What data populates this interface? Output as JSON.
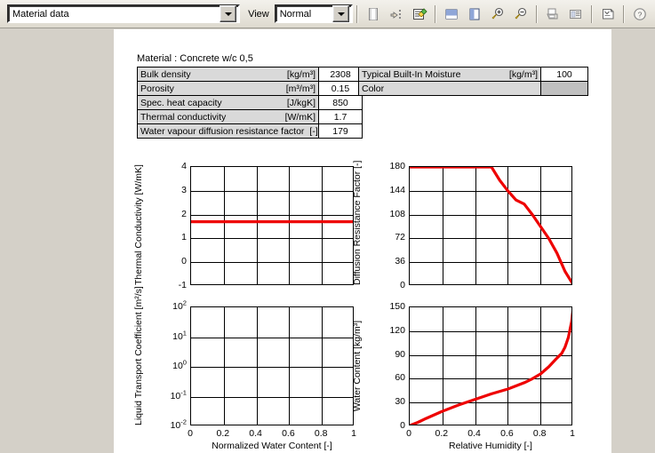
{
  "toolbar": {
    "material_combo": {
      "value": "Material data",
      "icon": "chevron-down-icon"
    },
    "view_label": "View",
    "view_combo": {
      "value": "Normal",
      "icon": "chevron-down-icon"
    },
    "buttons": [
      {
        "name": "new-document-icon",
        "title": "New"
      },
      {
        "name": "open-folder-icon",
        "title": "Open"
      },
      {
        "name": "edit-material-icon",
        "title": "Edit material"
      },
      {
        "name": "view-single-page-icon",
        "title": "Single page"
      },
      {
        "name": "view-full-page-icon",
        "title": "Full page"
      },
      {
        "name": "zoom-in-icon",
        "title": "Zoom in"
      },
      {
        "name": "zoom-out-icon",
        "title": "Zoom out"
      },
      {
        "name": "print-icon",
        "title": "Print"
      },
      {
        "name": "report-list-icon",
        "title": "Report"
      },
      {
        "name": "notes-icon",
        "title": "Notes"
      },
      {
        "name": "help-icon",
        "title": "Help"
      }
    ]
  },
  "document": {
    "material_title": "Material : Concrete w/c 0,5",
    "table_left": {
      "rows": [
        {
          "label": "Bulk density",
          "unit": "[kg/m³]",
          "value": "2308"
        },
        {
          "label": "Porosity",
          "unit": "[m³/m³]",
          "value": "0.15"
        },
        {
          "label": "Spec. heat capacity",
          "unit": "[J/kgK]",
          "value": "850"
        },
        {
          "label": "Thermal conductivity",
          "unit": "[W/mK]",
          "value": "1.7"
        },
        {
          "label": "Water vapour diffusion resistance factor",
          "unit": "[-]",
          "value": "179"
        }
      ]
    },
    "table_right": {
      "rows": [
        {
          "label": "Typical Built-In Moisture",
          "unit": "[kg/m³]",
          "value": "100",
          "swatch": false
        },
        {
          "label": "Color",
          "unit": "",
          "value": "",
          "swatch": true
        }
      ]
    }
  },
  "chart_data": [
    {
      "id": "thermal-conductivity",
      "type": "line",
      "title": "",
      "xlabel": "",
      "ylabel": "Thermal Conductivity [W/mK]",
      "xlim": [
        0,
        1
      ],
      "ylim": [
        -1,
        4
      ],
      "yticks": [
        -1,
        0,
        1,
        2,
        3,
        4
      ],
      "yticklabels": [
        "-1",
        "0",
        "1",
        "2",
        "3",
        "4"
      ],
      "xticks": [
        0,
        0.2,
        0.4,
        0.6,
        0.8,
        1
      ],
      "xticklabels": [
        "",
        "",
        "",
        "",
        "",
        ""
      ],
      "grid": true,
      "color": "#ee0000",
      "x": [
        0,
        0.2,
        0.4,
        0.6,
        0.8,
        1.0
      ],
      "y": [
        1.7,
        1.7,
        1.7,
        1.7,
        1.7,
        1.7
      ]
    },
    {
      "id": "diffusion-resistance-factor",
      "type": "line",
      "title": "",
      "xlabel": "",
      "ylabel": "Diffusion Resistance Factor [-]",
      "xlim": [
        0,
        1
      ],
      "ylim": [
        0,
        180
      ],
      "yticks": [
        0,
        36,
        72,
        108,
        144,
        180
      ],
      "yticklabels": [
        "0",
        "36",
        "72",
        "108",
        "144",
        "180"
      ],
      "xticks": [
        0,
        0.2,
        0.4,
        0.6,
        0.8,
        1
      ],
      "xticklabels": [
        "",
        "",
        "",
        "",
        "",
        ""
      ],
      "grid": true,
      "color": "#ee0000",
      "x": [
        0,
        0.1,
        0.2,
        0.3,
        0.4,
        0.5,
        0.55,
        0.6,
        0.65,
        0.7,
        0.75,
        0.8,
        0.85,
        0.9,
        0.95,
        1.0
      ],
      "y": [
        180,
        180,
        180,
        180,
        180,
        180,
        160,
        144,
        130,
        124,
        108,
        90,
        72,
        50,
        22,
        2
      ]
    },
    {
      "id": "liquid-transport-coefficient",
      "type": "line",
      "title": "",
      "xlabel": "Normalized Water Content [-]",
      "ylabel": "Liquid Transport Coefficient [m²/s]",
      "yscale": "log",
      "xlim": [
        0,
        1
      ],
      "ylim": [
        0.01,
        100
      ],
      "yticks": [
        0.01,
        0.1,
        1,
        10,
        100
      ],
      "yticklabels": [
        "10⁻²",
        "10⁻¹",
        "10⁰",
        "10¹",
        "10²"
      ],
      "xticks": [
        0,
        0.2,
        0.4,
        0.6,
        0.8,
        1
      ],
      "xticklabels": [
        "0",
        "0.2",
        "0.4",
        "0.6",
        "0.8",
        "1"
      ],
      "grid": true,
      "color": "#ee0000",
      "x": [],
      "y": []
    },
    {
      "id": "water-content",
      "type": "line",
      "title": "",
      "xlabel": "Relative Humidity [-]",
      "ylabel": "Water Content [kg/m³]",
      "xlim": [
        0,
        1
      ],
      "ylim": [
        0,
        150
      ],
      "yticks": [
        0,
        30,
        60,
        90,
        120,
        150
      ],
      "yticklabels": [
        "0",
        "30",
        "60",
        "90",
        "120",
        "150"
      ],
      "xticks": [
        0,
        0.2,
        0.4,
        0.6,
        0.8,
        1
      ],
      "xticklabels": [
        "0",
        "0.2",
        "0.4",
        "0.6",
        "0.8",
        "1"
      ],
      "grid": true,
      "color": "#ee0000",
      "x": [
        0,
        0.05,
        0.1,
        0.2,
        0.3,
        0.4,
        0.5,
        0.6,
        0.7,
        0.75,
        0.8,
        0.85,
        0.9,
        0.93,
        0.95,
        0.97,
        0.99,
        1.0
      ],
      "y": [
        1,
        5,
        10,
        19,
        27,
        34,
        41,
        47,
        55,
        60,
        66,
        75,
        86,
        92,
        100,
        112,
        132,
        150
      ]
    }
  ]
}
